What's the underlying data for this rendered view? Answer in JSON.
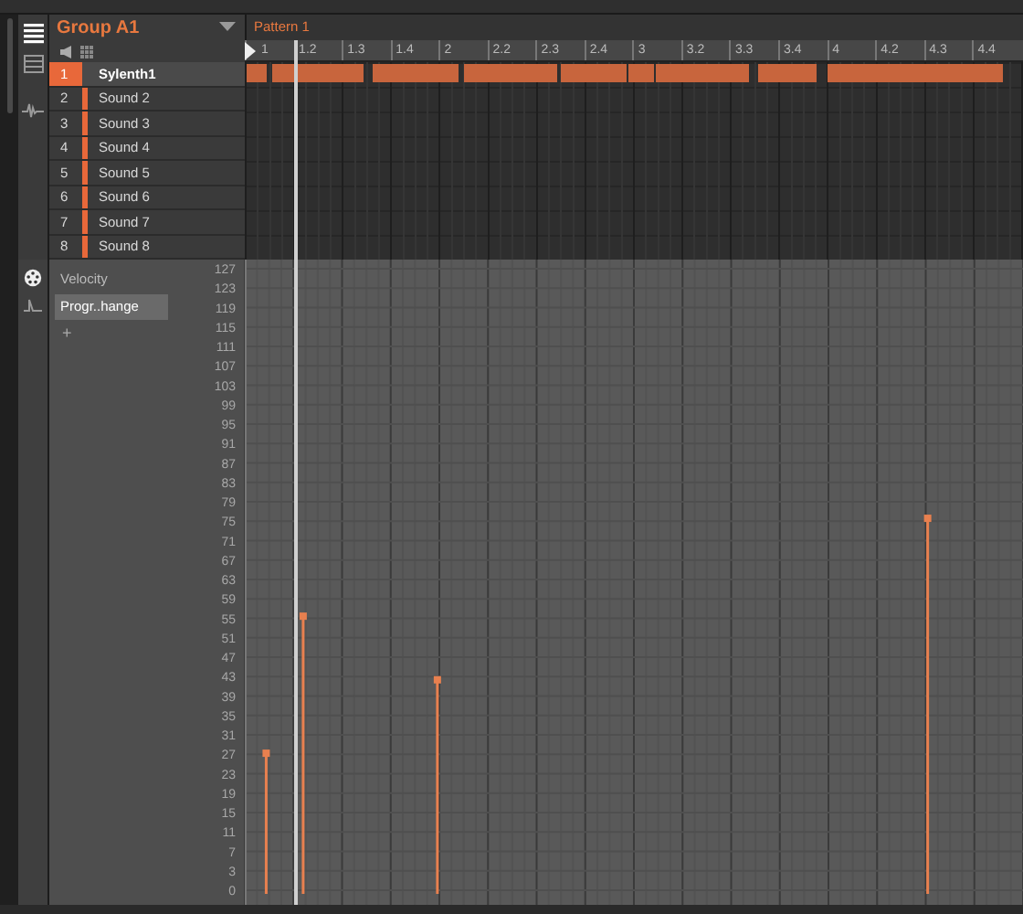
{
  "group": {
    "name": "Group A1"
  },
  "pattern": {
    "name": "Pattern 1"
  },
  "ruler": [
    "1",
    "1.2",
    "1.3",
    "1.4",
    "2",
    "2.2",
    "2.3",
    "2.4",
    "3",
    "3.2",
    "3.3",
    "3.4",
    "4",
    "4.2",
    "4.3",
    "4.4"
  ],
  "sounds": [
    {
      "number": "1",
      "name": "Sylenth1",
      "selected": true
    },
    {
      "number": "2",
      "name": "Sound 2",
      "selected": false
    },
    {
      "number": "3",
      "name": "Sound 3",
      "selected": false
    },
    {
      "number": "4",
      "name": "Sound 4",
      "selected": false
    },
    {
      "number": "5",
      "name": "Sound 5",
      "selected": false
    },
    {
      "number": "6",
      "name": "Sound 6",
      "selected": false
    },
    {
      "number": "7",
      "name": "Sound 7",
      "selected": false
    },
    {
      "number": "8",
      "name": "Sound 8",
      "selected": false
    }
  ],
  "lanes": [
    {
      "label": "Velocity",
      "selected": false
    },
    {
      "label": "Progr..hange",
      "selected": true
    }
  ],
  "add_lane": "+",
  "value_scale": [
    "127",
    "123",
    "119",
    "115",
    "111",
    "107",
    "103",
    "99",
    "95",
    "91",
    "87",
    "83",
    "79",
    "75",
    "71",
    "67",
    "63",
    "59",
    "55",
    "51",
    "47",
    "43",
    "39",
    "35",
    "31",
    "27",
    "23",
    "19",
    "15",
    "11",
    "7",
    "3",
    "0"
  ]
}
